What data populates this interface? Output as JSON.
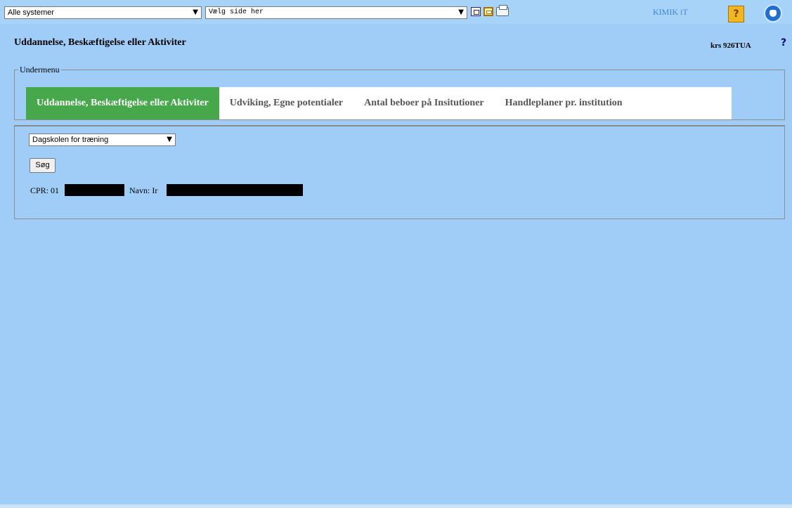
{
  "toolbar": {
    "system_select": "Alle systemer",
    "page_select": "Vælg side her",
    "brand": "KIMIK iT",
    "help_label": "?"
  },
  "header": {
    "title": "Uddannelse, Beskæftigelse eller Aktiviter",
    "user_code": "krs 926TUA",
    "help": "?"
  },
  "submenu": {
    "legend": "Undermenu",
    "tabs": [
      {
        "label": "Uddannelse, Beskæftigelse eller Aktiviter",
        "active": true
      },
      {
        "label": "Udviking, Egne potentialer",
        "active": false
      },
      {
        "label": "Antal beboer på Insitutioner",
        "active": false
      },
      {
        "label": "Handleplaner pr. institution",
        "active": false
      }
    ]
  },
  "main": {
    "institution_select": "Dagskolen for træning",
    "search_button": "Søg",
    "cpr_label": "CPR: 01",
    "name_label": "Navn: Ir"
  },
  "colors": {
    "background": "#9fcdf7",
    "active_tab": "#46a84a",
    "brand": "#3a89d6"
  },
  "icons": [
    "view-icon",
    "window-icon",
    "print-icon",
    "help-icon",
    "phone-icon",
    "chevron-down-icon"
  ]
}
